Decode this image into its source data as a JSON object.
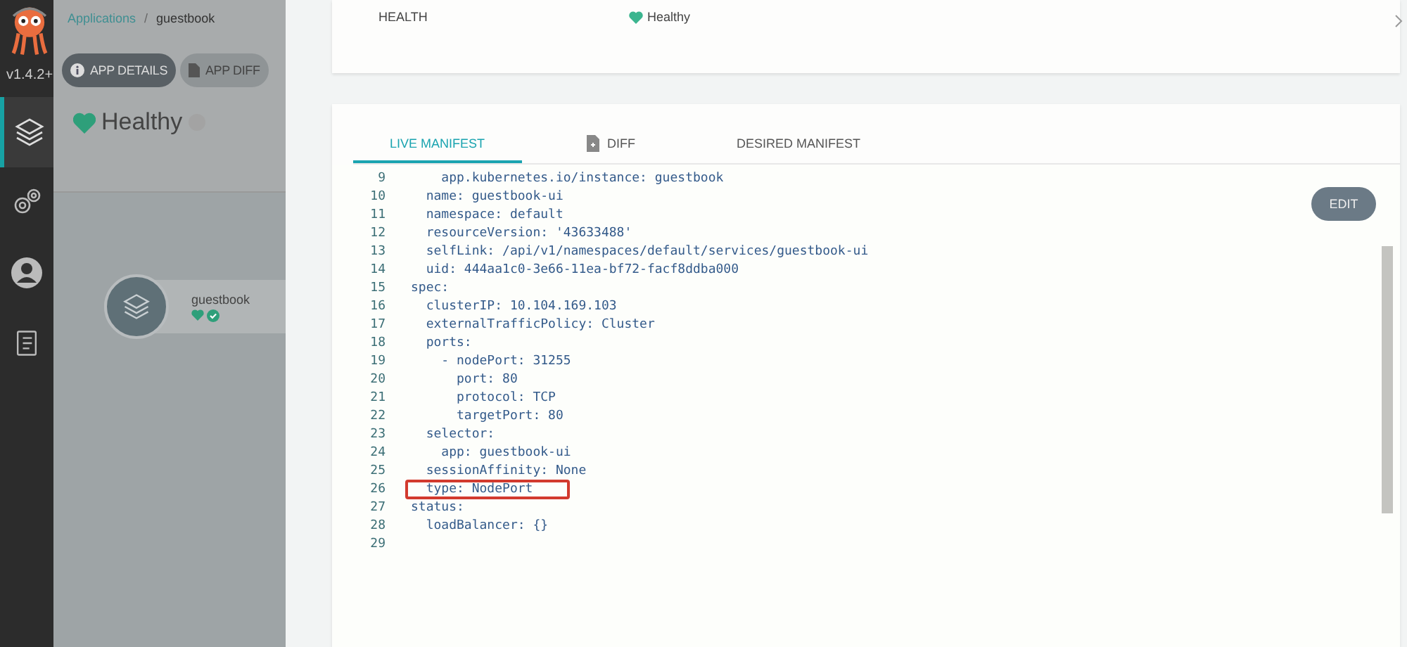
{
  "sidebar": {
    "version": "v1.4.2+",
    "items": [
      {
        "selected": true
      },
      {
        "selected": false
      },
      {
        "selected": false
      },
      {
        "selected": false
      }
    ]
  },
  "app_panel": {
    "breadcrumb": [
      {
        "label": "Applications",
        "kind": "link"
      },
      {
        "label": "guestbook",
        "kind": "current"
      }
    ],
    "breadcrumb_separator": "/",
    "buttons": [
      {
        "label": "APP DETAILS",
        "selected": true
      },
      {
        "label": "APP DIFF",
        "selected": false
      }
    ],
    "health": "Healthy",
    "node": {
      "name": "guestbook"
    }
  },
  "summary": {
    "label": "HEALTH",
    "value": "Healthy"
  },
  "tabs": [
    {
      "label": "LIVE MANIFEST",
      "selected": true
    },
    {
      "label": "DIFF",
      "selected": false
    },
    {
      "label": "DESIRED MANIFEST",
      "selected": false
    }
  ],
  "edit_button": "EDIT",
  "code_lines": [
    {
      "number": "9",
      "text": "    app.kubernetes.io/instance: guestbook"
    },
    {
      "number": "10",
      "text": "  name: guestbook-ui"
    },
    {
      "number": "11",
      "text": "  namespace: default"
    },
    {
      "number": "12",
      "text": "  resourceVersion: '43633488'"
    },
    {
      "number": "13",
      "text": "  selfLink: /api/v1/namespaces/default/services/guestbook-ui"
    },
    {
      "number": "14",
      "text": "  uid: 444aa1c0-3e66-11ea-bf72-facf8ddba000"
    },
    {
      "number": "15",
      "text": "spec:"
    },
    {
      "number": "16",
      "text": "  clusterIP: 10.104.169.103"
    },
    {
      "number": "17",
      "text": "  externalTrafficPolicy: Cluster"
    },
    {
      "number": "18",
      "text": "  ports:"
    },
    {
      "number": "19",
      "text": "    - nodePort: 31255"
    },
    {
      "number": "20",
      "text": "      port: 80"
    },
    {
      "number": "21",
      "text": "      protocol: TCP"
    },
    {
      "number": "22",
      "text": "      targetPort: 80"
    },
    {
      "number": "23",
      "text": "  selector:"
    },
    {
      "number": "24",
      "text": "    app: guestbook-ui"
    },
    {
      "number": "25",
      "text": "  sessionAffinity: None"
    },
    {
      "number": "26",
      "text": "  type: NodePort",
      "highlighted": true
    },
    {
      "number": "27",
      "text": "status:"
    },
    {
      "number": "28",
      "text": "  loadBalancer: {}"
    },
    {
      "number": "29"
    }
  ]
}
